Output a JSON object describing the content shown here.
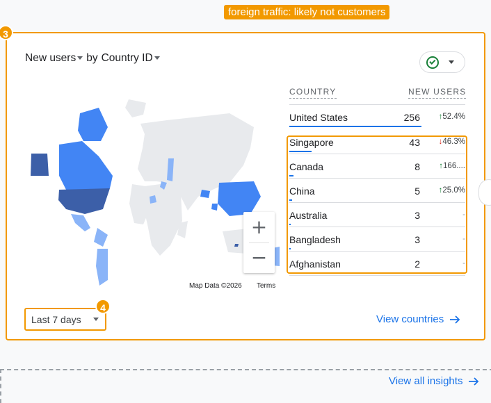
{
  "annotation": {
    "label": "foreign traffic: likely not customers"
  },
  "markers": {
    "card": "3",
    "date_range": "4"
  },
  "card": {
    "metric_label": "New users",
    "dimension_join": "by",
    "dimension_label": "Country ID",
    "check_icon": "check-circle-icon",
    "map": {
      "attribution": "Map Data ©2026",
      "terms": "Terms",
      "zoom_in": "+",
      "zoom_out": "−"
    },
    "table": {
      "headers": {
        "country": "COUNTRY",
        "users": "NEW USERS"
      },
      "rows": [
        {
          "country": "United States",
          "value": "256",
          "change_dir": "up",
          "change_icon": "arrow-up-icon",
          "change": "52.4%",
          "share": 1.0
        },
        {
          "country": "Singapore",
          "value": "43",
          "change_dir": "down",
          "change_icon": "arrow-down-icon",
          "change": "46.3%",
          "share": 0.168
        },
        {
          "country": "Canada",
          "value": "8",
          "change_dir": "up",
          "change_icon": "arrow-up-icon",
          "change": "166....",
          "share": 0.031
        },
        {
          "country": "China",
          "value": "5",
          "change_dir": "up",
          "change_icon": "arrow-up-icon",
          "change": "25.0%",
          "share": 0.02
        },
        {
          "country": "Australia",
          "value": "3",
          "change_dir": "none",
          "change_icon": "",
          "change": "-",
          "share": 0.012
        },
        {
          "country": "Bangladesh",
          "value": "3",
          "change_dir": "none",
          "change_icon": "",
          "change": "-",
          "share": 0.012
        },
        {
          "country": "Afghanistan",
          "value": "2",
          "change_dir": "none",
          "change_icon": "",
          "change": "-",
          "share": 0.008
        }
      ]
    },
    "date_range": "Last 7 days",
    "view_link": "View countries"
  },
  "footer": {
    "view_all": "View all insights"
  },
  "colors": {
    "accent_orange": "#f29900",
    "link_blue": "#1a73e8",
    "map_dark": "#3c5fa8",
    "map_mid": "#4285f4",
    "map_light": "#8ab4f8",
    "map_land": "#e8eaed",
    "up": "#188038",
    "down": "#d93025"
  }
}
